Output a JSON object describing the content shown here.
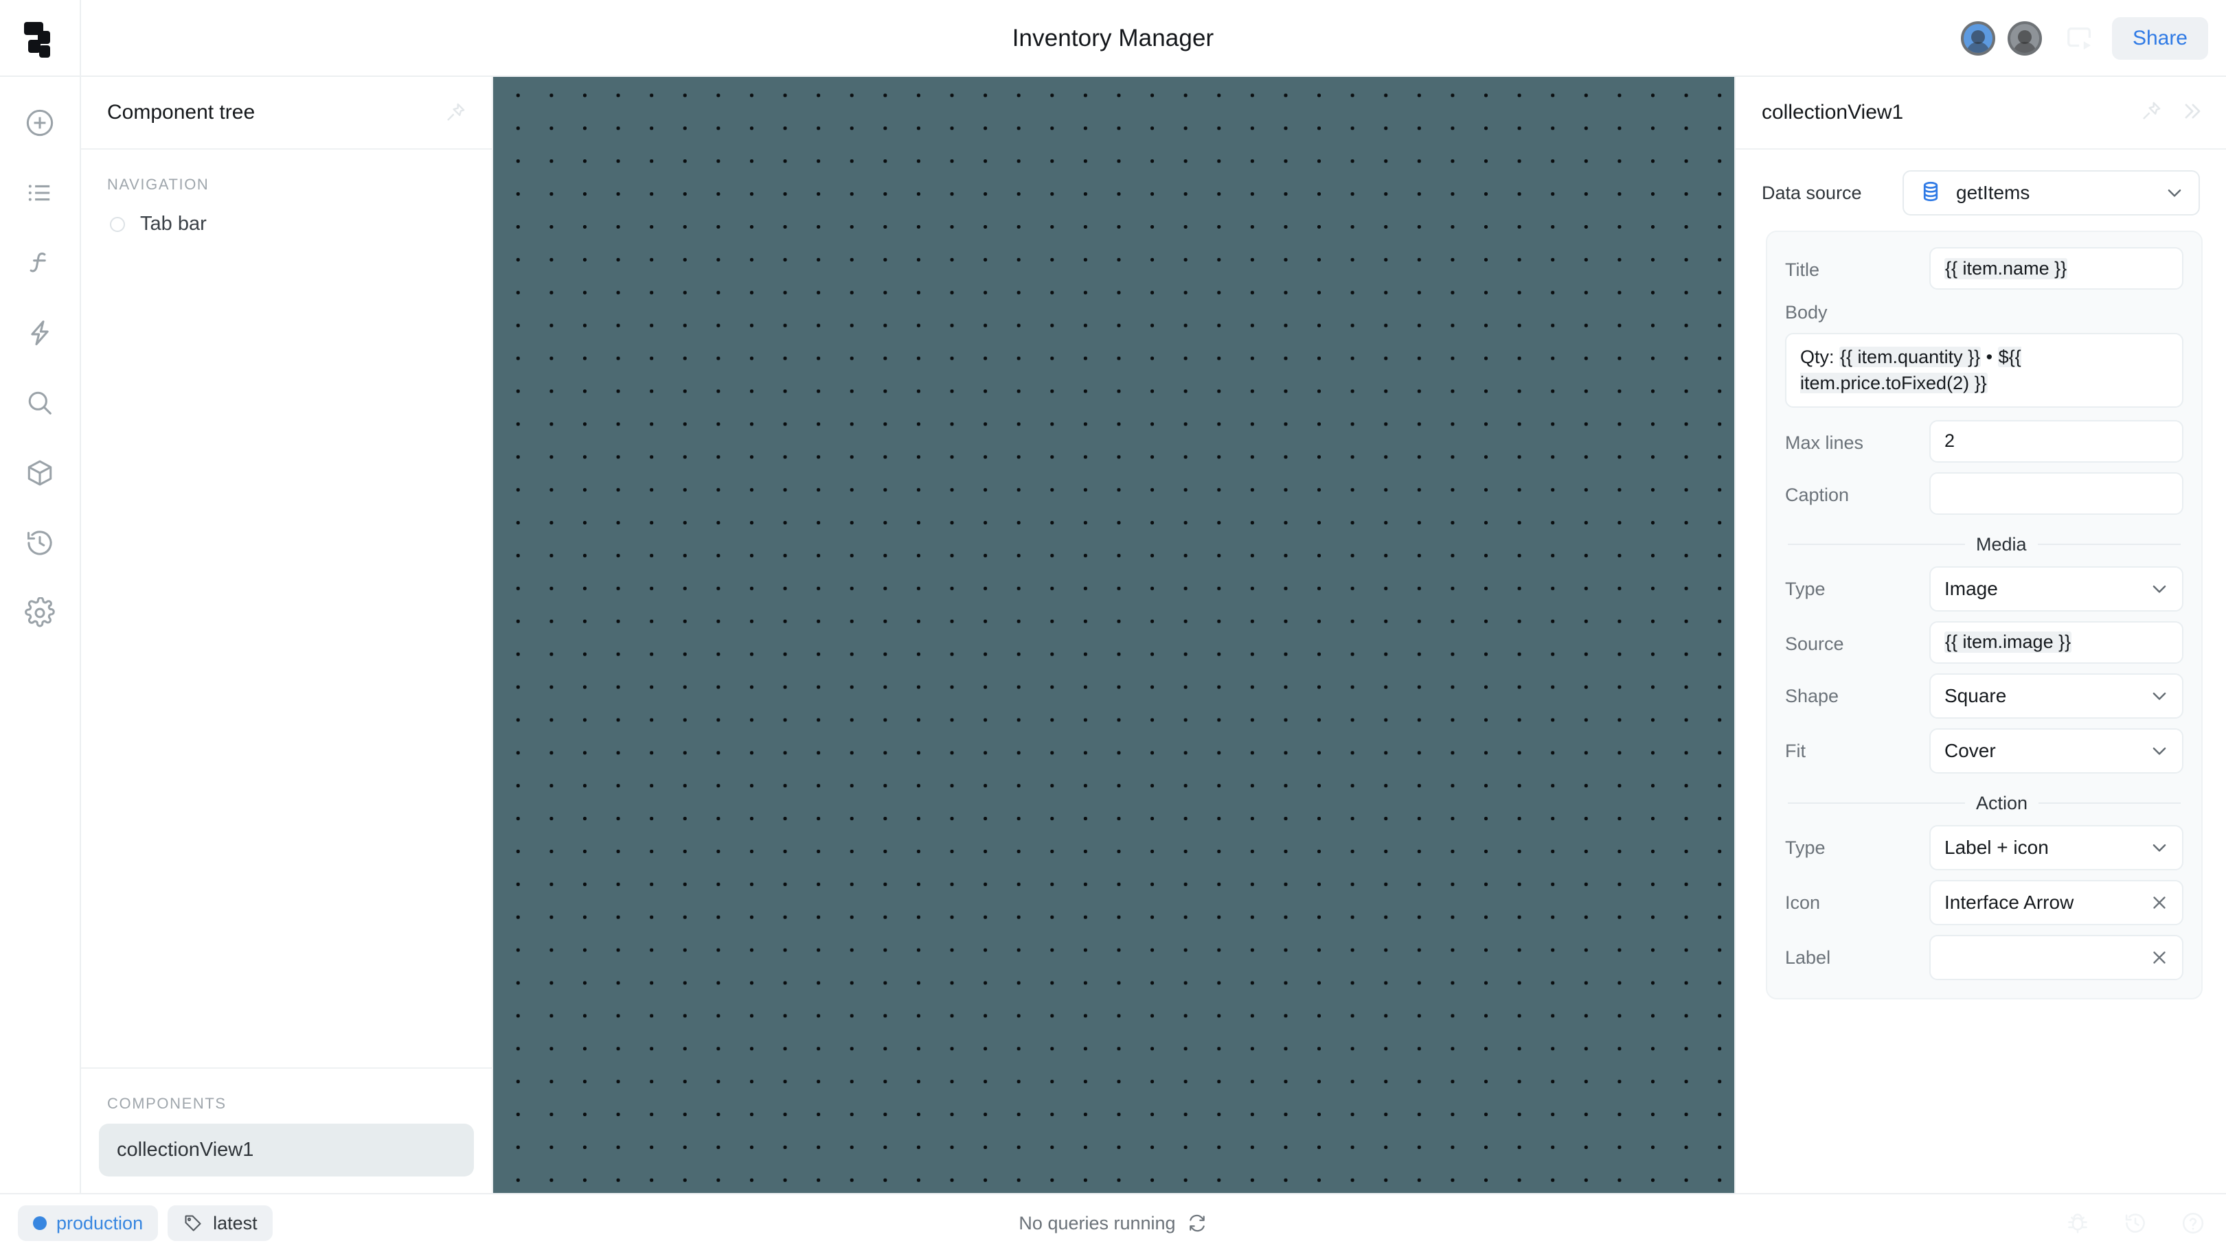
{
  "app": {
    "title": "Inventory Manager",
    "logo_name": "retool-logo"
  },
  "topbar": {
    "share_label": "Share",
    "preview_icon": "preview-play-icon",
    "avatars": [
      {
        "name": "avatar-user-1"
      },
      {
        "name": "avatar-user-2"
      }
    ]
  },
  "rail": {
    "items": [
      {
        "icon": "add-circle-icon",
        "name": "add-component"
      },
      {
        "icon": "list-icon",
        "name": "component-tree"
      },
      {
        "icon": "function-icon",
        "name": "code"
      },
      {
        "icon": "lightning-icon",
        "name": "workflows"
      },
      {
        "icon": "search-icon",
        "name": "search"
      },
      {
        "icon": "cube-icon",
        "name": "modules"
      },
      {
        "icon": "history-icon",
        "name": "history"
      },
      {
        "icon": "gear-icon",
        "name": "settings"
      }
    ]
  },
  "tree": {
    "header": "Component tree",
    "pin_icon": "pin-icon",
    "navigation_label": "NAVIGATION",
    "navigation_items": [
      {
        "label": "Tab bar"
      }
    ],
    "components_label": "COMPONENTS",
    "components": [
      {
        "label": "collectionView1",
        "selected": true
      }
    ]
  },
  "inspector": {
    "title": "collectionView1",
    "pin_icon": "pin-icon",
    "collapse_icon": "chevron-double-right-icon",
    "data_source": {
      "label": "Data source",
      "value": "getItems",
      "icon": "database-icon"
    },
    "fields": {
      "title": {
        "label": "Title",
        "value": "{{ item.name }}"
      },
      "body": {
        "label": "Body",
        "value": "Qty: {{ item.quantity }} • ${{ item.price.toFixed(2) }}",
        "parts": [
          {
            "t": "Qty: ",
            "tpl": false
          },
          {
            "t": "{{ item.quantity }}",
            "tpl": true
          },
          {
            "t": " • ",
            "tpl": false
          },
          {
            "t": "${{",
            "tpl": true
          },
          {
            "t": " ",
            "tpl": false
          },
          {
            "t": "item.price.toFixed(2) }}",
            "tpl": true
          }
        ]
      },
      "max_lines": {
        "label": "Max lines",
        "value": "2"
      },
      "caption": {
        "label": "Caption",
        "value": ""
      }
    },
    "media": {
      "section_label": "Media",
      "type": {
        "label": "Type",
        "value": "Image"
      },
      "source": {
        "label": "Source",
        "value": "{{ item.image }}"
      },
      "shape": {
        "label": "Shape",
        "value": "Square"
      },
      "fit": {
        "label": "Fit",
        "value": "Cover"
      }
    },
    "action": {
      "section_label": "Action",
      "type": {
        "label": "Type",
        "value": "Label + icon"
      },
      "icon": {
        "label": "Icon",
        "value": "Interface Arrow",
        "clear_icon": "close-icon"
      },
      "label_field": {
        "label": "Label",
        "value": "",
        "clear_icon": "close-icon"
      }
    }
  },
  "bottombar": {
    "environment": "production",
    "release_tag": "latest",
    "status": "No queries running",
    "refresh_icon": "refresh-icon",
    "right_icons": [
      {
        "name": "bug-icon"
      },
      {
        "name": "history-icon"
      },
      {
        "name": "help-icon"
      }
    ]
  },
  "colors": {
    "accent": "#3786e0",
    "canvas": "#4d6a72",
    "canvas_dot": "#0b0e10",
    "selected_row": "#e7ecee",
    "border": "#eceff1"
  }
}
